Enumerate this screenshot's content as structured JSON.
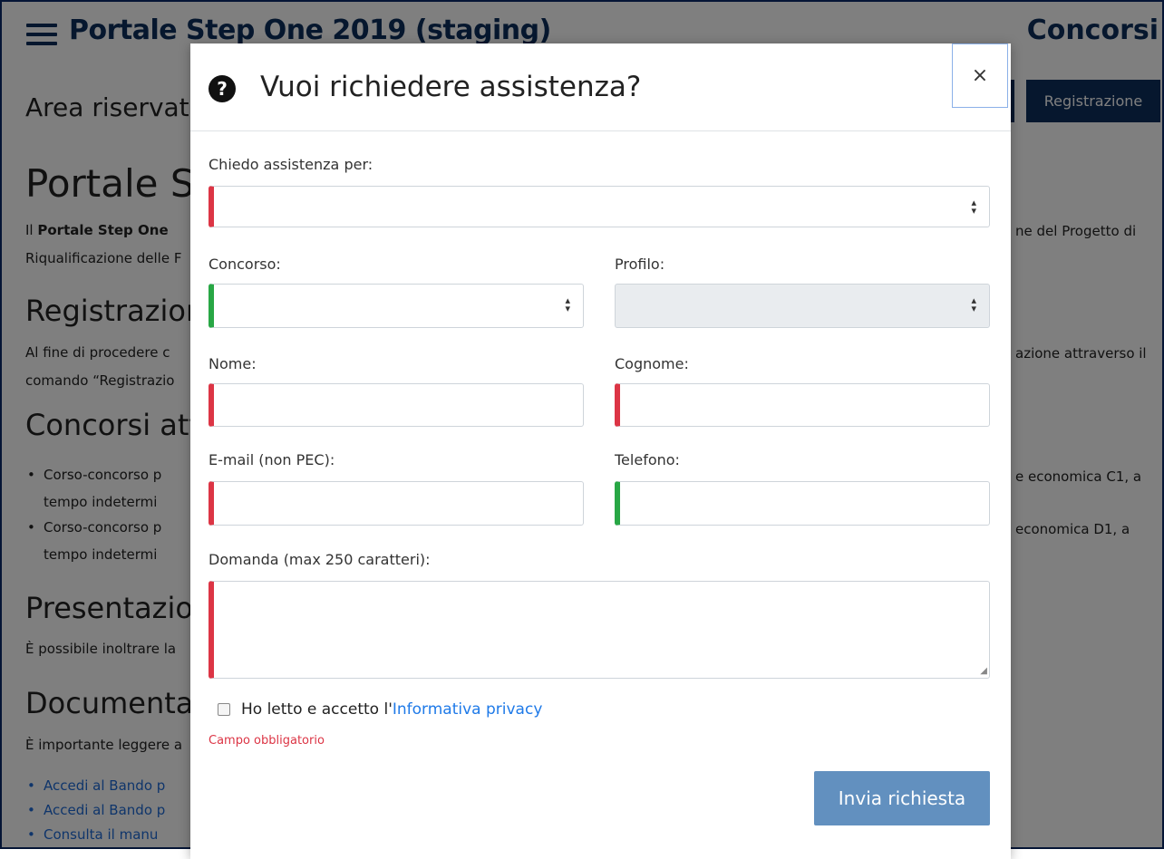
{
  "background": {
    "app_title": "Portale Step One 2019 (staging)",
    "top_right_title": "Concorsi",
    "area_title": "Area riservat",
    "register_button": "Registrazione",
    "h1": "Portale St",
    "intro_line1_bold": "Portale Step One",
    "intro_line1_prefix": "Il",
    "intro_line1_right": "ne del Progetto di",
    "intro_line2": "Riqualificazione delle F",
    "h2_registration": "Registrazion",
    "reg_line1": "Al fine di procedere c",
    "reg_line1_right": "azione attraverso il",
    "reg_line2": "comando “Registrazio",
    "h2_contests": "Concorsi atti",
    "bullet1_line1": "Corso-concorso p",
    "bullet1_right": "e economica C1, a",
    "bullet1_line2": "tempo indetermi",
    "bullet2_line1": "Corso-concorso p",
    "bullet2_right": "economica D1, a",
    "bullet2_line2": "tempo indetermi",
    "h2_presentation": "Presentazio",
    "pres_line": "È possibile inoltrare la",
    "h2_docs": "Documentaz",
    "docs_line": "È importante leggere a",
    "link1": "Accedi al Bando p",
    "link2": "Accedi al Bando p",
    "link3": "Consulta il manu"
  },
  "modal": {
    "title": "Vuoi richiedere assistenza?",
    "help_icon": "question-circle-icon",
    "close_label": "×",
    "labels": {
      "assistance_for": "Chiedo assistenza per:",
      "contest": "Concorso:",
      "profile": "Profilo:",
      "name": "Nome:",
      "surname": "Cognome:",
      "email": "E-mail (non PEC):",
      "phone": "Telefono:",
      "question": "Domanda (max 250 caratteri):"
    },
    "privacy_text": "Ho letto e accetto l'",
    "privacy_link": "Informativa privacy",
    "required_error": "Campo obbligatorio",
    "submit_label": "Invia richiesta"
  },
  "colors": {
    "primary_dark": "#0c2e5c",
    "required": "#dc3545",
    "valid": "#28a745",
    "submit": "#6290bf",
    "link": "#1f7ae8"
  }
}
